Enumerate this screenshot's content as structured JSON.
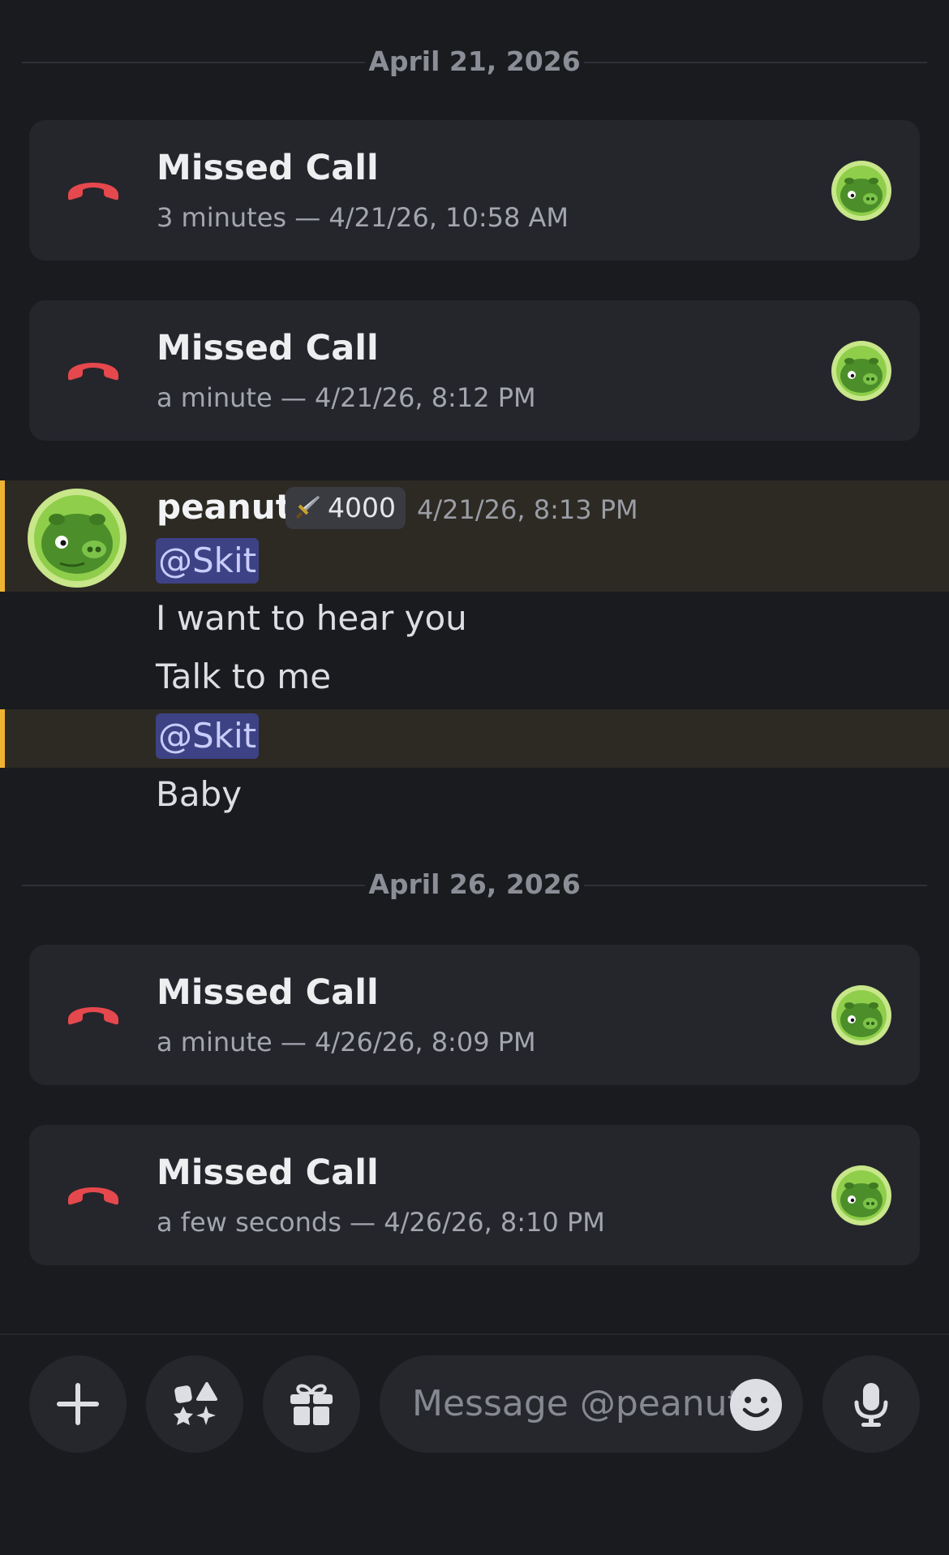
{
  "colors": {
    "background": "#1a1b1f",
    "card": "#25262c",
    "missed_red": "#e5484d",
    "mention_bg": "#3d4285",
    "highlight_bar": "#f0b232"
  },
  "dividers": [
    {
      "label": "April 21, 2026"
    },
    {
      "label": "April 26, 2026"
    }
  ],
  "calls": [
    {
      "title": "Missed Call",
      "meta": "3 minutes — 4/21/26, 10:58 AM",
      "icon": "phone-hangup-icon"
    },
    {
      "title": "Missed Call",
      "meta": "a minute — 4/21/26, 8:12 PM",
      "icon": "phone-hangup-icon"
    },
    {
      "title": "Missed Call",
      "meta": "a minute — 4/26/26, 8:09 PM",
      "icon": "phone-hangup-icon"
    },
    {
      "title": "Missed Call",
      "meta": "a few seconds — 4/26/26, 8:10 PM",
      "icon": "phone-hangup-icon"
    }
  ],
  "message_group": {
    "username": "peanut",
    "badge_value": "4000",
    "badge_icon": "sword-icon",
    "timestamp": "4/21/26, 8:13 PM",
    "lines": [
      {
        "type": "mention",
        "text": "@Skit"
      },
      {
        "type": "text",
        "text": "I want to hear you"
      },
      {
        "type": "text",
        "text": "Talk to me"
      },
      {
        "type": "mention",
        "text": "@Skit"
      },
      {
        "type": "text",
        "text": "Baby"
      }
    ]
  },
  "composer": {
    "placeholder": "Message @peanut",
    "buttons": [
      "plus-icon",
      "apps-icon",
      "gift-icon",
      "mic-icon"
    ]
  }
}
